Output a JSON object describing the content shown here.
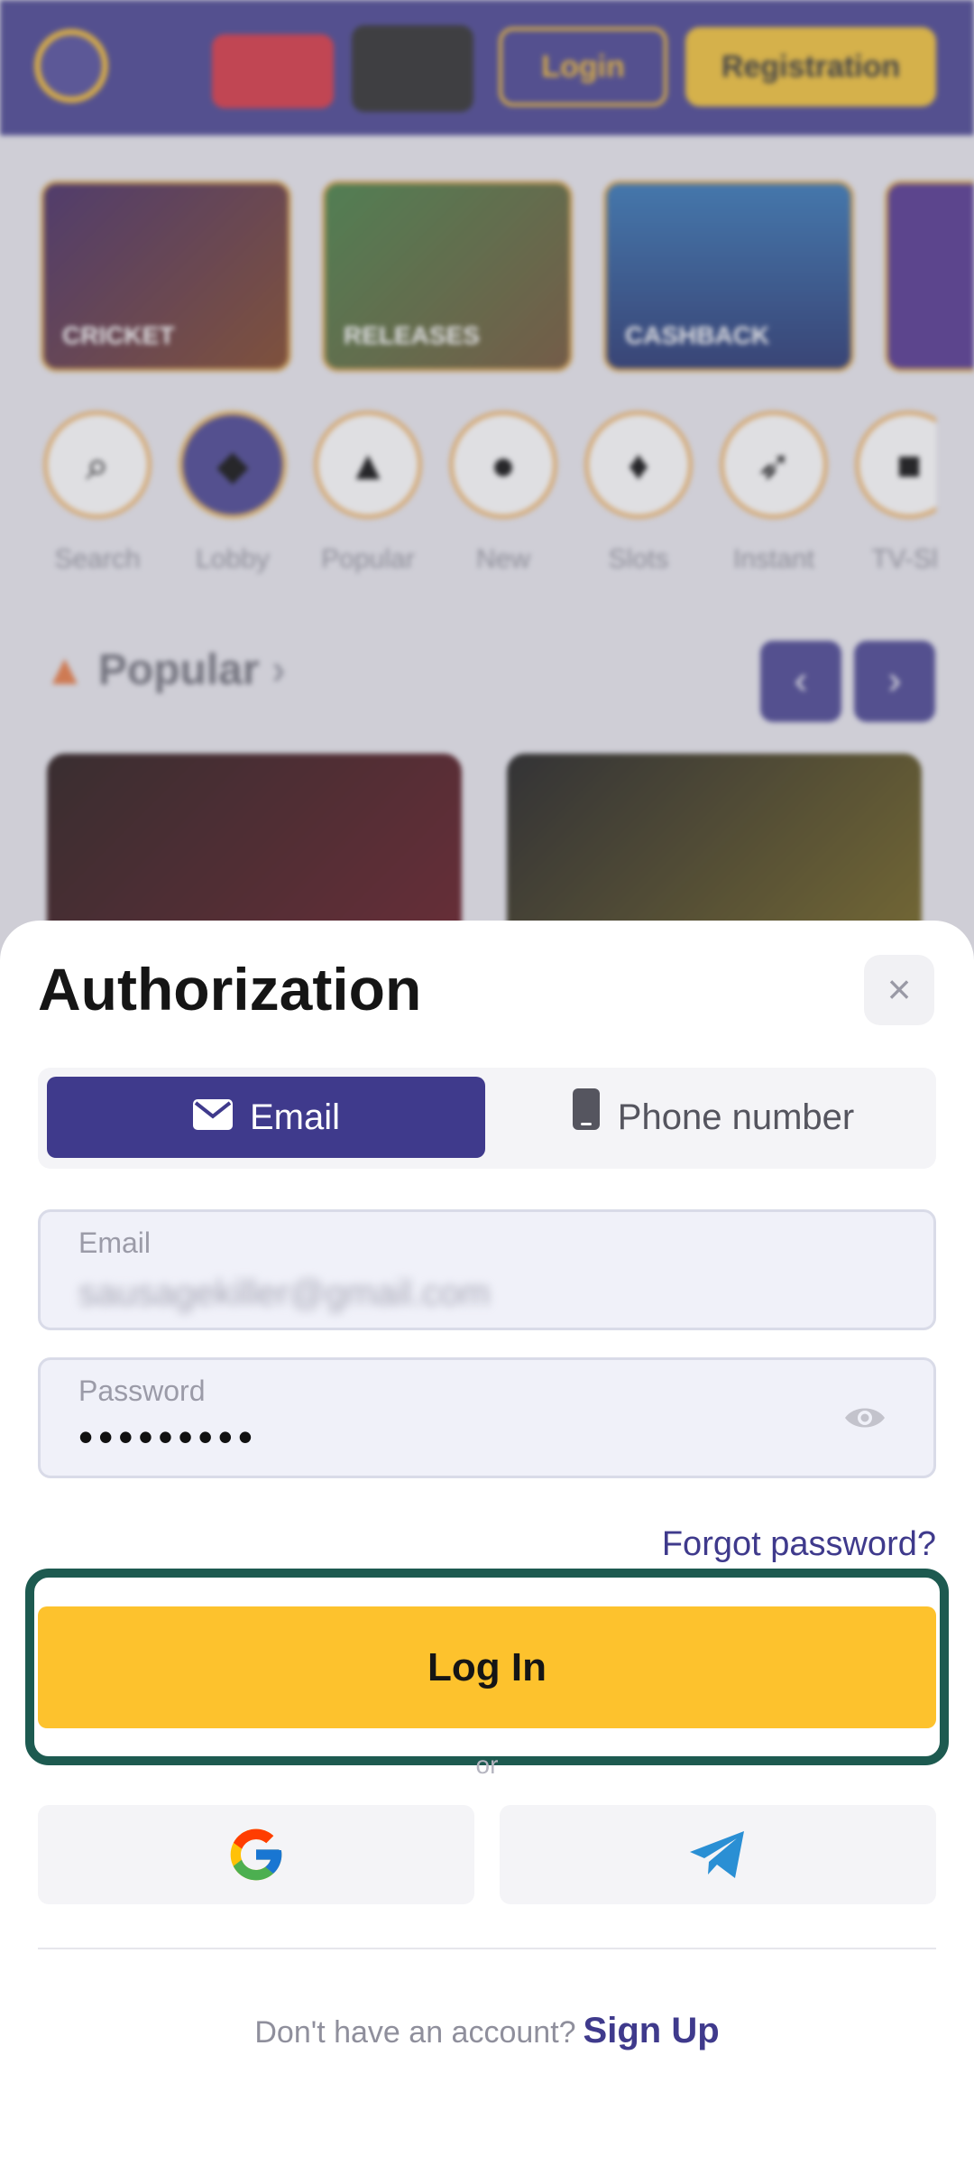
{
  "header": {
    "logo_text": "",
    "promo_badge_1": "",
    "promo_badge_2": "",
    "login_label": "Login",
    "registration_label": "Registration"
  },
  "promos": [
    "CRICKET",
    "RELEASES",
    "CASHBACK"
  ],
  "categories": [
    "Search",
    "Lobby",
    "Popular",
    "New",
    "Slots",
    "Instant",
    "TV-Sh"
  ],
  "section": {
    "popular_title": "Popular"
  },
  "modal": {
    "title": "Authorization",
    "tabs": {
      "email": "Email",
      "phone": "Phone number"
    },
    "email_field": {
      "label": "Email",
      "value": "sausagekiller@gmail.com"
    },
    "password_field": {
      "label": "Password",
      "value": "•••••••••"
    },
    "forgot_password": "Forgot password?",
    "login_button": "Log In",
    "or_text": "or",
    "signup_prompt": "Don't have an account?",
    "signup_link": "Sign Up"
  },
  "colors": {
    "brand_purple": "#3f3a8c",
    "accent_yellow": "#fdc22d",
    "highlight_green": "#1d5a50"
  }
}
